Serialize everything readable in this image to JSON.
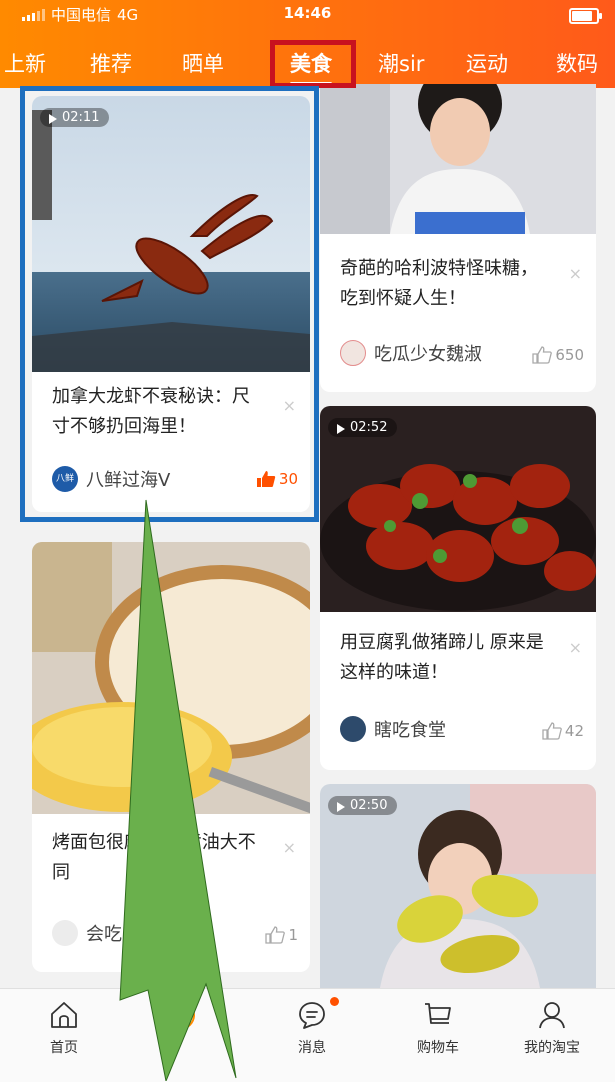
{
  "status": {
    "carrier": "中国电信",
    "network": "4G",
    "time": "14:46"
  },
  "tabs": [
    "上新",
    "推荐",
    "晒单",
    "美食",
    "潮sir",
    "运动",
    "数码"
  ],
  "active_tab": "美食",
  "cards": [
    {
      "duration": "02:11",
      "title": "加拿大龙虾不衰秘诀：尺寸不够扔回海里！",
      "author": "八鲜过海V",
      "likes": "30",
      "avatar_text": "八鲜"
    },
    {
      "duration": "",
      "title": "奇葩的哈利波特怪味糖，吃到怀疑人生！",
      "author": "吃瓜少女魏淑",
      "likes": "650"
    },
    {
      "duration": "02:52",
      "title": "用豆腐乳做猪蹄儿 原来是这样的味道！",
      "author": "瞎吃食堂",
      "likes": "42"
    },
    {
      "duration": "",
      "title": "烤面包很麻烦 是黄油大不同",
      "author": "会吃的馨",
      "likes": "1"
    },
    {
      "duration": "02:50",
      "title": "",
      "author": "",
      "likes": ""
    }
  ],
  "close_glyph": "×",
  "bottom_nav": [
    "首页",
    "",
    "消息",
    "购物车",
    "我的淘宝"
  ],
  "colors": {
    "brand": "#ff5000",
    "annotation_red": "#c8121f",
    "annotation_blue": "#1e6fbf",
    "annotation_arrow": "#6ab04c"
  },
  "icons": [
    "home-icon",
    "message-icon",
    "cart-icon",
    "profile-icon",
    "thumbs-up-icon",
    "play-icon",
    "close-icon"
  ]
}
